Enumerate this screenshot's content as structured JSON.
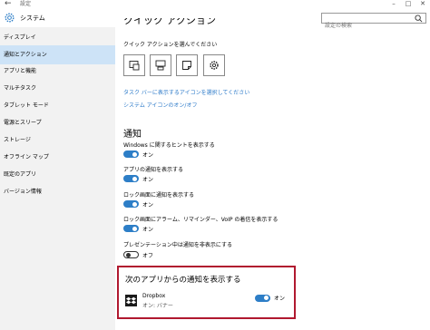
{
  "window": {
    "title": "設定",
    "back_icon": "back-arrow-icon"
  },
  "header": {
    "title": "システム",
    "search_placeholder": "設定の検索"
  },
  "sidebar": {
    "items": [
      {
        "label": "ディスプレイ",
        "active": false
      },
      {
        "label": "通知とアクション",
        "active": true
      },
      {
        "label": "アプリと機能",
        "active": false
      },
      {
        "label": "マルチタスク",
        "active": false
      },
      {
        "label": "タブレット モード",
        "active": false
      },
      {
        "label": "電源とスリープ",
        "active": false
      },
      {
        "label": "ストレージ",
        "active": false
      },
      {
        "label": "オフライン マップ",
        "active": false
      },
      {
        "label": "既定のアプリ",
        "active": false
      },
      {
        "label": "バージョン情報",
        "active": false
      }
    ]
  },
  "quick_actions": {
    "title": "クイック アクション",
    "description": "クイック アクションを選んでください",
    "tiles": [
      "tablet-mode-icon",
      "connect-icon",
      "note-icon",
      "settings-icon"
    ],
    "link_taskbar_icons": "タスク バーに表示するアイコンを選択してください",
    "link_system_icons": "システム アイコンのオン/オフ"
  },
  "notifications": {
    "title": "通知",
    "settings": [
      {
        "label": "Windows に関するヒントを表示する",
        "state": "オン",
        "on": true
      },
      {
        "label": "アプリの通知を表示する",
        "state": "オン",
        "on": true
      },
      {
        "label": "ロック画面に通知を表示する",
        "state": "オン",
        "on": true
      },
      {
        "label": "ロック画面にアラーム、リマインダー、VoIP の着信を表示する",
        "state": "オン",
        "on": true
      },
      {
        "label": "プレゼンテーション中は通知を非表示にする",
        "state": "オフ",
        "on": false
      }
    ]
  },
  "app_notifications": {
    "title": "次のアプリからの通知を表示する",
    "apps": [
      {
        "name": "Dropbox",
        "subtitle": "オン: バナー",
        "state": "オン",
        "on": true
      }
    ]
  },
  "colors": {
    "accent": "#2d7ec7",
    "highlight_border": "#b0182f",
    "sidebar_active": "#cde3f7"
  }
}
